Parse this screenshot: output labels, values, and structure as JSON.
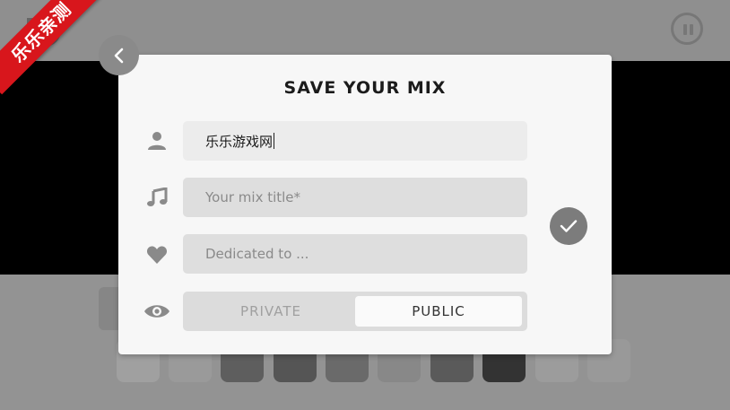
{
  "corner_badge": {
    "text": "乐乐亲测",
    "color": "#d8161c"
  },
  "dialog": {
    "title": "SAVE YOUR MIX",
    "author": {
      "value": "乐乐游戏网",
      "icon": "person-icon"
    },
    "mix_title": {
      "value": "",
      "placeholder": "Your mix title*",
      "icon": "music-note-icon"
    },
    "dedication": {
      "value": "",
      "placeholder": "Dedicated to ...",
      "icon": "heart-icon"
    },
    "visibility": {
      "icon": "eye-icon",
      "options": [
        "PRIVATE",
        "PUBLIC"
      ],
      "selected": "PUBLIC"
    },
    "back_icon": "chevron-left-icon",
    "confirm_icon": "check-icon"
  },
  "colors": {
    "background": "#8e8e8e",
    "stage": "#000000",
    "dialog": "#f7f7f7",
    "field": "#dedede"
  }
}
